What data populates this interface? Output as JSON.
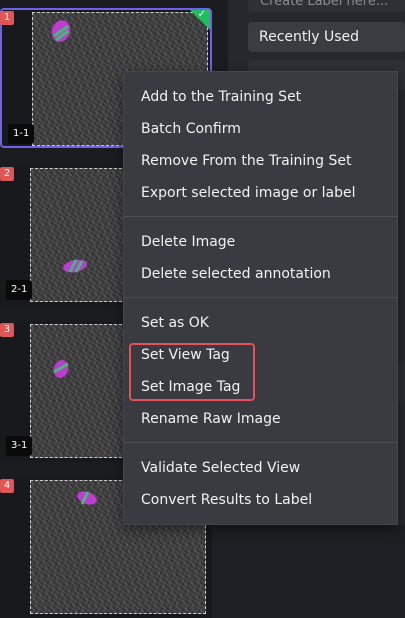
{
  "thumbnails": [
    {
      "index": "1",
      "view": "1-1"
    },
    {
      "index": "2",
      "view": "2-1"
    },
    {
      "index": "3",
      "view": "3-1"
    },
    {
      "index": "4",
      "view": ""
    }
  ],
  "panel": {
    "input_placeholder": "Create Label here...",
    "dropdown_value": "Recently Used"
  },
  "menu": {
    "group1": [
      "Add to the Training Set",
      "Batch Confirm",
      "Remove From the Training Set",
      "Export selected image or label"
    ],
    "group2": [
      "Delete Image",
      "Delete selected annotation"
    ],
    "group3": [
      "Set as OK",
      "Set View Tag",
      "Set Image Tag",
      "Rename Raw Image"
    ],
    "group4": [
      "Validate Selected View",
      "Convert Results to Label"
    ]
  },
  "colors": {
    "selection": "#6c63e8",
    "badge": "#e05656",
    "confirmed": "#1fbf5a",
    "highlight": "#e8505b",
    "label_fill": "#c23ad6",
    "label_stripe": "#3dbf73"
  }
}
